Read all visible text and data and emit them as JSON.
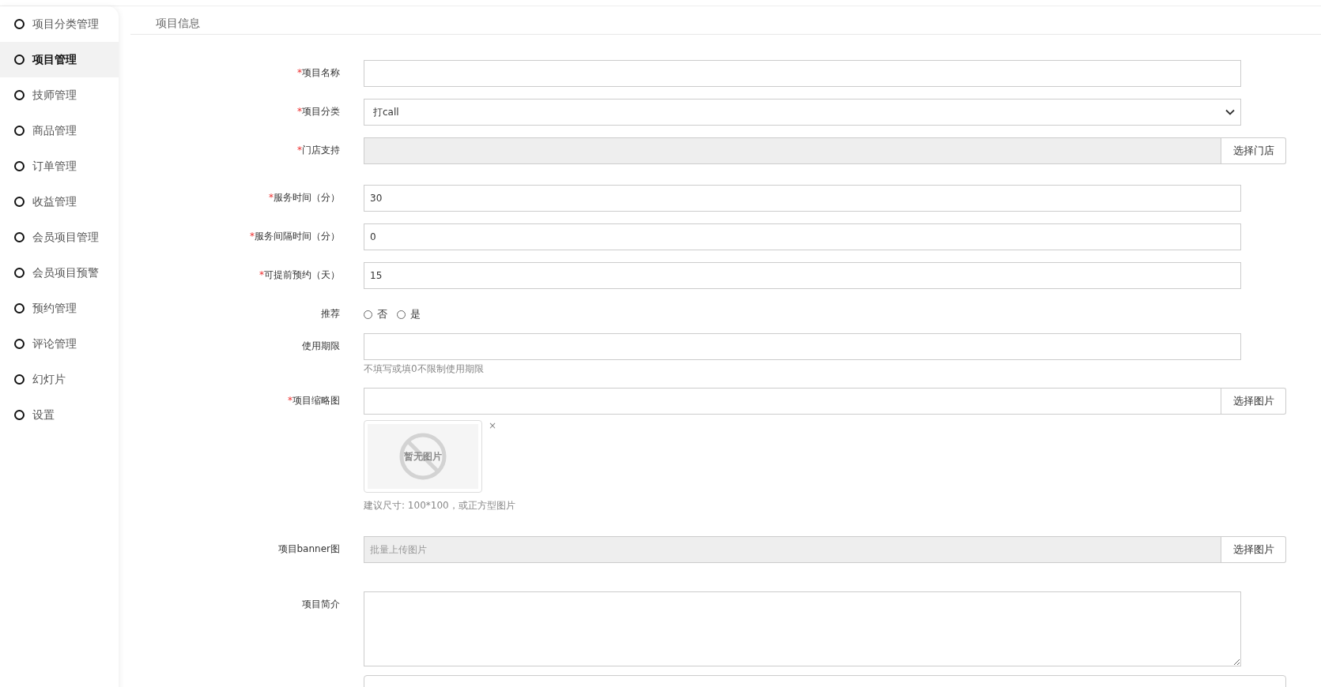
{
  "sidebar": {
    "items": [
      {
        "label": "项目分类管理",
        "selected": false
      },
      {
        "label": "项目管理",
        "selected": true
      },
      {
        "label": "技师管理",
        "selected": false
      },
      {
        "label": "商品管理",
        "selected": false
      },
      {
        "label": "订单管理",
        "selected": false
      },
      {
        "label": "收益管理",
        "selected": false
      },
      {
        "label": "会员项目管理",
        "selected": false
      },
      {
        "label": "会员项目预警",
        "selected": false
      },
      {
        "label": "预约管理",
        "selected": false
      },
      {
        "label": "评论管理",
        "selected": false
      },
      {
        "label": "幻灯片",
        "selected": false
      },
      {
        "label": "设置",
        "selected": false
      }
    ]
  },
  "section_title": "项目信息",
  "form": {
    "fields": [
      {
        "kind": "text",
        "required_mark": "*",
        "label": "项目名称"
      },
      {
        "kind": "select",
        "required_mark": "*",
        "label": "项目分类",
        "value": "打call"
      },
      {
        "kind": "picker",
        "required_mark": "*",
        "label": "门店支持",
        "disabled": true,
        "button": "选择门店"
      },
      {
        "kind": "text",
        "required_mark": "*",
        "label": "服务时间（分）",
        "value": "30"
      },
      {
        "kind": "text",
        "required_mark": "*",
        "label": "服务间隔时间（分）",
        "value": "0"
      },
      {
        "kind": "text",
        "required_mark": "*",
        "label": "可提前预约（天）",
        "value": "15"
      },
      {
        "kind": "radio",
        "label": "推荐",
        "options": [
          {
            "label": "否",
            "selected": false
          },
          {
            "label": "是",
            "selected": false
          }
        ]
      },
      {
        "kind": "text",
        "label": "使用期限",
        "hint": "不填写或填0不限制使用期限"
      },
      {
        "kind": "image",
        "required_mark": "*",
        "label": "项目缩略图",
        "button": "选择图片",
        "preview_text": "暂无图片",
        "remove": "×",
        "hint": "建议尺寸: 100*100，或正方型图片"
      },
      {
        "kind": "picker",
        "label": "项目banner图",
        "disabled": true,
        "placeholder": "批量上传图片",
        "button": "选择图片"
      },
      {
        "kind": "textarea",
        "label": "项目简介"
      }
    ]
  }
}
